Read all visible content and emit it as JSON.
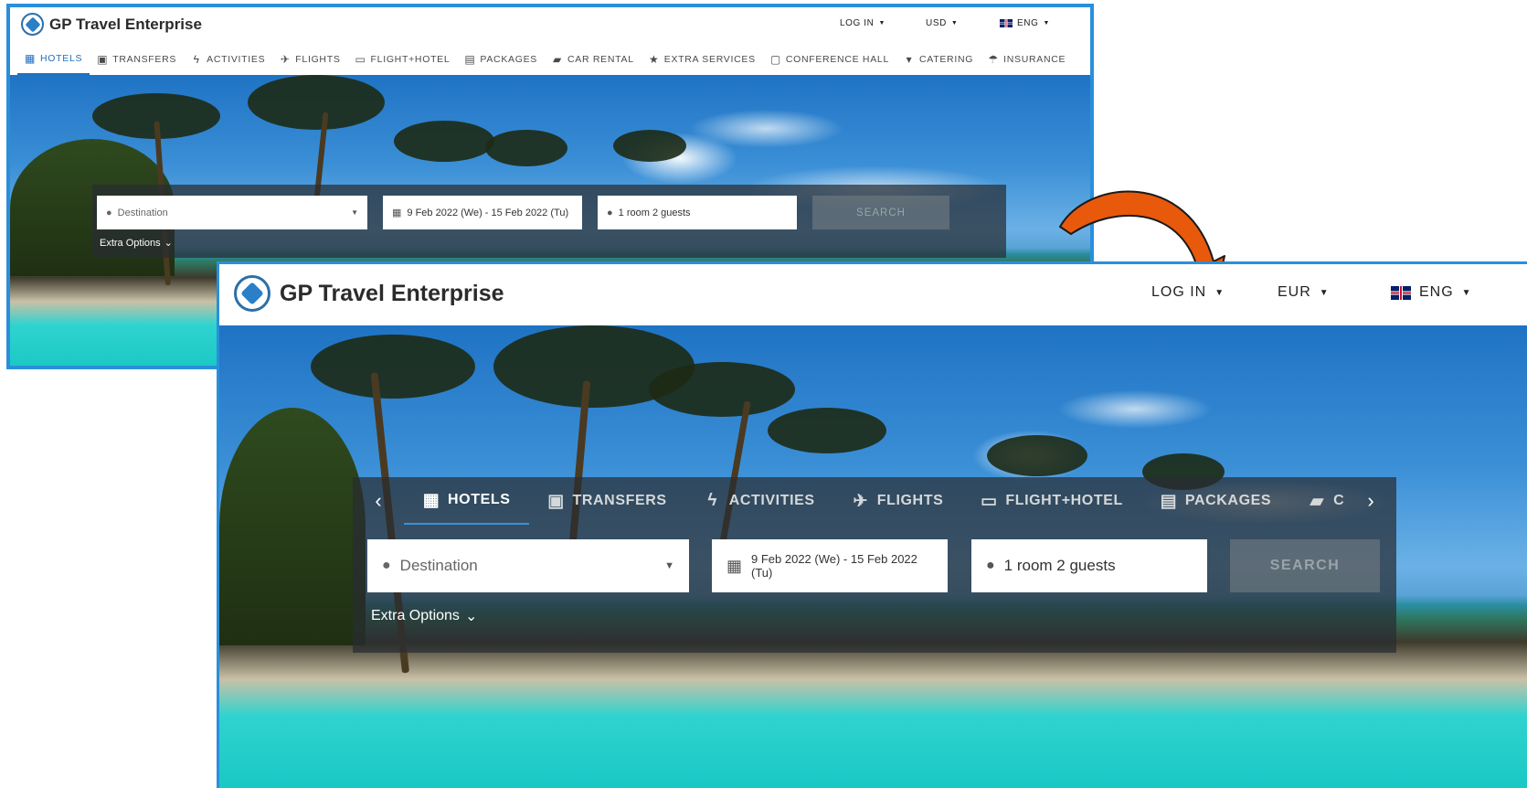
{
  "before": {
    "brand": "GP Travel Enterprise",
    "header": {
      "login": "LOG IN",
      "currency": "USD",
      "language": "ENG"
    },
    "tabs": [
      {
        "label": "HOTELS",
        "icon": "building-icon",
        "active": true
      },
      {
        "label": "TRANSFERS",
        "icon": "bus-icon"
      },
      {
        "label": "ACTIVITIES",
        "icon": "lightning-icon"
      },
      {
        "label": "FLIGHTS",
        "icon": "plane-icon"
      },
      {
        "label": "FLIGHT+HOTEL",
        "icon": "ticket-icon"
      },
      {
        "label": "PACKAGES",
        "icon": "briefcase-icon"
      },
      {
        "label": "CAR RENTAL",
        "icon": "car-icon"
      },
      {
        "label": "EXTRA SERVICES",
        "icon": "star-box-icon"
      },
      {
        "label": "CONFERENCE HALL",
        "icon": "monitor-icon"
      },
      {
        "label": "CATERING",
        "icon": "cup-icon"
      },
      {
        "label": "INSURANCE",
        "icon": "umbrella-icon"
      }
    ],
    "search": {
      "destination_placeholder": "Destination",
      "dates": "9 Feb 2022 (We) -  15 Feb 2022 (Tu)",
      "guests": "1 room 2 guests",
      "search_button": "SEARCH",
      "extra_options": "Extra Options"
    }
  },
  "after": {
    "brand": "GP Travel Enterprise",
    "header": {
      "login": "LOG IN",
      "currency": "EUR",
      "language": "ENG"
    },
    "tabs": [
      {
        "label": "HOTELS",
        "icon": "building-icon",
        "active": true
      },
      {
        "label": "TRANSFERS",
        "icon": "bus-icon"
      },
      {
        "label": "ACTIVITIES",
        "icon": "lightning-icon"
      },
      {
        "label": "FLIGHTS",
        "icon": "plane-icon"
      },
      {
        "label": "FLIGHT+HOTEL",
        "icon": "ticket-icon"
      },
      {
        "label": "PACKAGES",
        "icon": "briefcase-icon"
      },
      {
        "label": "CAR RENTAL",
        "icon": "car-icon"
      }
    ],
    "search": {
      "destination_placeholder": "Destination",
      "dates": "9 Feb 2022 (We) -  15 Feb 2022 (Tu)",
      "guests": "1 room 2 guests",
      "search_button": "SEARCH",
      "extra_options": "Extra Options"
    }
  },
  "colors": {
    "accent": "#2a8fdb",
    "arrow": "#e8590c",
    "active_tab": "#1f6fbd"
  }
}
